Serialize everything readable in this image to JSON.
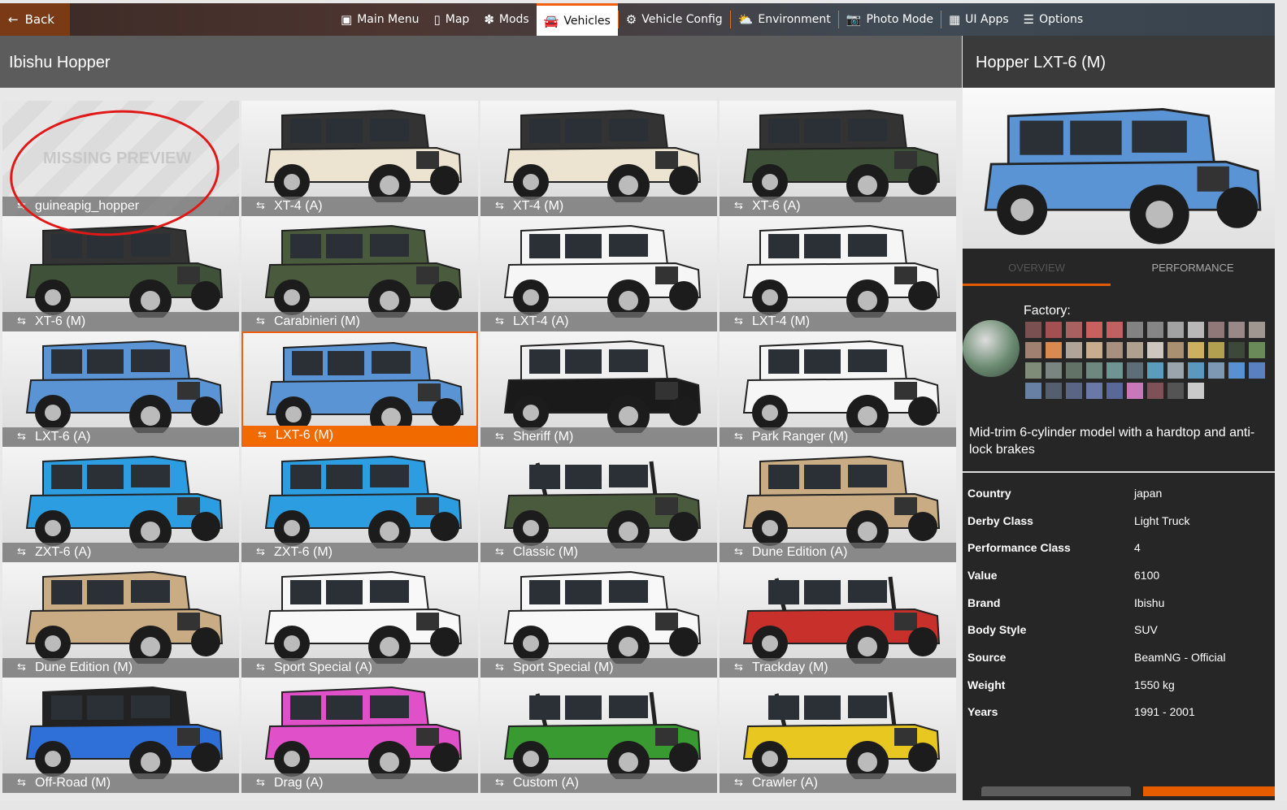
{
  "topbar": {
    "back": "Back",
    "nav": [
      {
        "label": "Main Menu",
        "icon": "main-menu-icon",
        "glyph": "▣"
      },
      {
        "label": "Map",
        "icon": "map-icon",
        "glyph": "▯"
      },
      {
        "label": "Mods",
        "icon": "puzzle-icon",
        "glyph": "✽"
      },
      {
        "label": "Vehicles",
        "icon": "car-icon",
        "glyph": "🚘",
        "active": true
      },
      {
        "label": "Vehicle Config",
        "icon": "engine-icon",
        "glyph": "⚙"
      },
      {
        "label": "Environment",
        "icon": "weather-icon",
        "glyph": "⛅"
      },
      {
        "label": "Photo Mode",
        "icon": "camera-icon",
        "glyph": "📷"
      },
      {
        "label": "UI Apps",
        "icon": "apps-icon",
        "glyph": "▦"
      },
      {
        "label": "Options",
        "icon": "sliders-icon",
        "glyph": "☰"
      }
    ]
  },
  "left": {
    "title": "Ibishu Hopper",
    "missing_preview": "MISSING PREVIEW"
  },
  "configs": [
    {
      "label": "guineapig_hopper",
      "color": null
    },
    {
      "label": "XT-4 (A)",
      "color": "#ece4d0",
      "top": "#333"
    },
    {
      "label": "XT-4 (M)",
      "color": "#ece4d0",
      "top": "#333"
    },
    {
      "label": "XT-6 (A)",
      "color": "#3f5138",
      "top": "#333"
    },
    {
      "label": "XT-6 (M)",
      "color": "#3f5138",
      "top": "#333"
    },
    {
      "label": "Carabinieri (M)",
      "color": "#4a5a3c",
      "top": "#4a5a3c"
    },
    {
      "label": "LXT-4 (A)",
      "color": "#f6f6f6",
      "top": "#f6f6f6"
    },
    {
      "label": "LXT-4 (M)",
      "color": "#f6f6f6",
      "top": "#f6f6f6"
    },
    {
      "label": "LXT-6 (A)",
      "color": "#5b94d4",
      "top": "#5b94d4"
    },
    {
      "label": "LXT-6 (M)",
      "color": "#5b94d4",
      "top": "#5b94d4",
      "selected": true
    },
    {
      "label": "Sheriff (M)",
      "color": "#1a1a1a",
      "top": "#f0f0f0"
    },
    {
      "label": "Park Ranger (M)",
      "color": "#f6f6f6",
      "top": "#f6f6f6"
    },
    {
      "label": "ZXT-6 (A)",
      "color": "#2b9de0",
      "top": "#2b9de0"
    },
    {
      "label": "ZXT-6 (M)",
      "color": "#2b9de0",
      "top": "#2b9de0"
    },
    {
      "label": "Classic (M)",
      "color": "#4a5a3c",
      "top": null
    },
    {
      "label": "Dune Edition (A)",
      "color": "#c9ac84",
      "top": "#c9ac84"
    },
    {
      "label": "Dune Edition (M)",
      "color": "#c9ac84",
      "top": "#c9ac84"
    },
    {
      "label": "Sport Special (A)",
      "color": "#f8f8f8",
      "top": "#f8f8f8"
    },
    {
      "label": "Sport Special (M)",
      "color": "#f8f8f8",
      "top": "#f8f8f8"
    },
    {
      "label": "Trackday (M)",
      "color": "#c8302c",
      "top": null
    },
    {
      "label": "Off-Road (M)",
      "color": "#2f6fd8",
      "top": "#222"
    },
    {
      "label": "Drag (A)",
      "color": "#e050c8",
      "top": "#e050c8"
    },
    {
      "label": "Custom (A)",
      "color": "#3a9a32",
      "top": null
    },
    {
      "label": "Crawler (A)",
      "color": "#e8c820",
      "top": null
    }
  ],
  "detail": {
    "title": "Hopper LXT-6 (M)",
    "body_color": "#5b94d4",
    "tabs": {
      "overview": "OVERVIEW",
      "performance": "PERFORMANCE"
    },
    "paint_label": "Factory:",
    "swatches": [
      "#7a5050",
      "#a45050",
      "#a86060",
      "#c86060",
      "#c06060",
      "#828282",
      "#868686",
      "#a2a2a2",
      "#b8b8b8",
      "#907878",
      "#988888",
      "#a09890",
      "#a08070",
      "#d88a50",
      "#b0a498",
      "#c8ac90",
      "#a89080",
      "#b0a090",
      "#ccc6be",
      "#a89070",
      "#ccb060",
      "#b0a050",
      "#3e483a",
      "#6a8a5a",
      "#7e8c78",
      "#7a8480",
      "#627266",
      "#6e8880",
      "#6e9494",
      "#5e6e78",
      "#5a9cbc",
      "#9aa4ac",
      "#5a98c0",
      "#7e98b4",
      "#5890d0",
      "#5a80c0",
      "#6880a4",
      "#545e6c",
      "#5a6484",
      "#6a78a8",
      "#5a6898",
      "#c878b8",
      "#7e5058",
      "#545454",
      "#cacaca"
    ],
    "description": "Mid-trim 6-cylinder model with a hardtop and anti-lock brakes",
    "specs": [
      {
        "key": "Country",
        "value": "japan"
      },
      {
        "key": "Derby Class",
        "value": "Light Truck"
      },
      {
        "key": "Performance Class",
        "value": "4"
      },
      {
        "key": "Value",
        "value": "6100"
      },
      {
        "key": "Brand",
        "value": "Ibishu"
      },
      {
        "key": "Body Style",
        "value": "SUV"
      },
      {
        "key": "Source",
        "value": "BeamNG - Official"
      },
      {
        "key": "Weight",
        "value": "1550 kg"
      },
      {
        "key": "Years",
        "value": "1991 - 2001"
      }
    ]
  }
}
